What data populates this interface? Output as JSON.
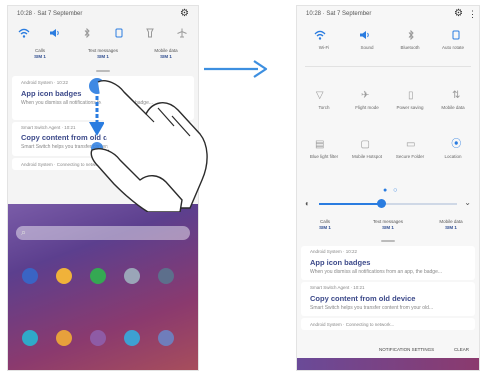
{
  "left_panel": {
    "status_time": "10:28 · Sat 7 September",
    "quick_settings": [
      {
        "icon": "wifi-icon",
        "on": true
      },
      {
        "icon": "sound-icon",
        "on": true
      },
      {
        "icon": "bluetooth-icon",
        "on": false
      },
      {
        "icon": "auto-rotate-icon",
        "on": true
      },
      {
        "icon": "flashlight-icon",
        "on": false
      },
      {
        "icon": "airplane-icon",
        "on": false
      }
    ],
    "sim_info": [
      {
        "label": "Calls",
        "value": "SIM 1"
      },
      {
        "label": "Text messages",
        "value": "SIM 1"
      },
      {
        "label": "Mobile data",
        "value": "SIM 1"
      }
    ],
    "notifications": [
      {
        "app": "Android System · 10:22",
        "title": "App icon badges",
        "body": "When you dismiss all notifications from an app, the badge..."
      },
      {
        "app": "Smart Switch Agent · 10:21",
        "title": "Copy content from old device",
        "body": "Smart Switch helps you transfer content from your old..."
      }
    ],
    "collapsed_row": "Android System · Connecting to network..."
  },
  "right_panel": {
    "status_time": "10:28 · Sat 7 September",
    "tiles": [
      {
        "label": "Wi-Fi",
        "icon": "wifi-icon",
        "on": true
      },
      {
        "label": "Sound",
        "icon": "sound-icon",
        "on": true
      },
      {
        "label": "Bluetooth",
        "icon": "bluetooth-icon",
        "on": false
      },
      {
        "label": "Auto rotate",
        "icon": "auto-rotate-icon",
        "on": true
      },
      {
        "label": "Torch",
        "icon": "flashlight-icon",
        "on": false
      },
      {
        "label": "Flight mode",
        "icon": "airplane-icon",
        "on": false
      },
      {
        "label": "Power saving",
        "icon": "battery-icon",
        "on": false
      },
      {
        "label": "Mobile data",
        "icon": "data-icon",
        "on": false
      },
      {
        "label": "Blue light filter",
        "icon": "bluelight-icon",
        "on": false
      },
      {
        "label": "Mobile Hotspot",
        "icon": "hotspot-icon",
        "on": false
      },
      {
        "label": "Secure Folder",
        "icon": "folder-icon",
        "on": false
      },
      {
        "label": "Location",
        "icon": "location-icon",
        "on": true
      }
    ],
    "brightness_percent": 45,
    "sim_info": [
      {
        "label": "Calls",
        "value": "SIM 1"
      },
      {
        "label": "Text messages",
        "value": "SIM 1"
      },
      {
        "label": "Mobile data",
        "value": "SIM 1"
      }
    ],
    "notifications": [
      {
        "app": "Android System · 10:22",
        "title": "App icon badges",
        "body": "When you dismiss all notifications from an app, the badge..."
      },
      {
        "app": "Smart Switch Agent · 10:21",
        "title": "Copy content from old device",
        "body": "Smart Switch helps you transfer content from your old..."
      }
    ],
    "collapsed_row": "Android System · Connecting to network...",
    "bottom_buttons": {
      "settings": "NOTIFICATION SETTINGS",
      "clear": "CLEAR"
    }
  },
  "colors": {
    "accent": "#2a7ce0",
    "title": "#3d4a8a",
    "arrow": "#3d8fe0"
  }
}
